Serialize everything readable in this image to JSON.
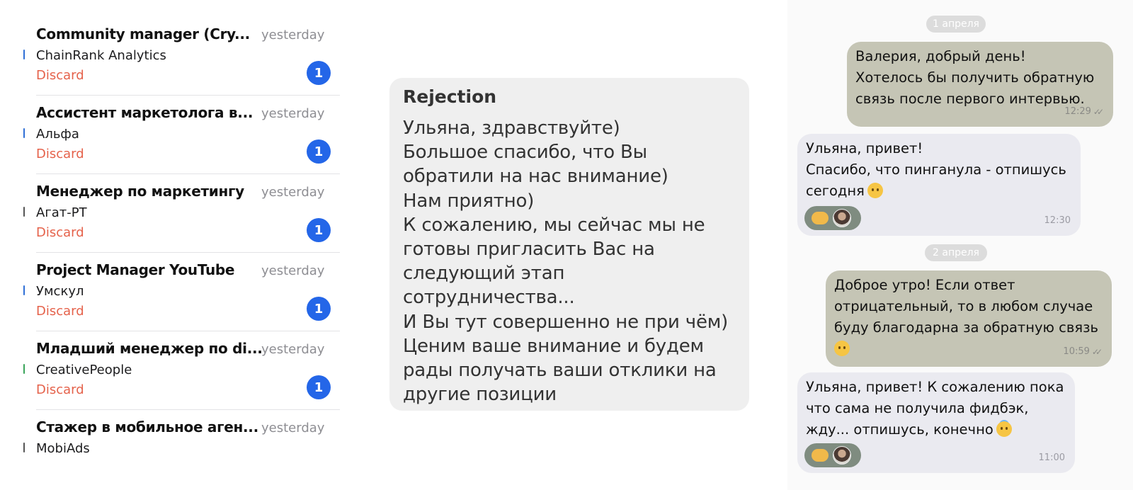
{
  "jobs": [
    {
      "title": "Community manager (Cry...",
      "time": "yesterday",
      "company": "ChainRank Analytics",
      "action": "Discard",
      "badge": "1",
      "edge_color": "#2f6fd6"
    },
    {
      "title": "Ассистент маркетолога в...",
      "time": "yesterday",
      "company": "Альфа",
      "action": "Discard",
      "badge": "1",
      "edge_color": "#2f6fd6"
    },
    {
      "title": "Менеджер по маркетингу",
      "time": "yesterday",
      "company": "Агат-РТ",
      "action": "Discard",
      "badge": "1",
      "edge_color": "#555555"
    },
    {
      "title": "Project Manager YouTube",
      "time": "yesterday",
      "company": "Умскул",
      "action": "Discard",
      "badge": "1",
      "edge_color": "#2f6fd6"
    },
    {
      "title": "Младший менеджер по di...",
      "time": "yesterday",
      "company": "CreativePeople",
      "action": "Discard",
      "badge": "1",
      "edge_color": "#3aa45a"
    },
    {
      "title": "Стажер в мобильное аген...",
      "time": "yesterday",
      "company": "MobiAds",
      "action": "",
      "badge": "",
      "edge_color": "#555555"
    }
  ],
  "rejection": {
    "title": "Rejection",
    "lines": [
      "Ульяна, здравствуйте)",
      "Большое спасибо, что Вы",
      "обратили на нас внимание)",
      "Нам приятно)",
      "К сожалению, мы сейчас мы не",
      "готовы пригласить Вас на",
      "следующий этап",
      "сотрудничества...",
      "И Вы тут совершенно не при чём)",
      "Ценим ваше внимание и будем",
      "рады получать ваши отклики на",
      "другие позиции"
    ]
  },
  "chat": {
    "date1": "1 апреля",
    "date2": "2 апреля",
    "msg1": {
      "lines": [
        "Валерия, добрый день!",
        "Хотелось бы получить обратную",
        "связь после первого интервью."
      ],
      "time": "12:29"
    },
    "msg2": {
      "lines": [
        "Ульяна, привет!",
        "Спасибо, что пинганула - отпишусь",
        "сегодня"
      ],
      "time": "12:30"
    },
    "msg3": {
      "lines": [
        "Доброе утро! Если ответ",
        "отрицательный, то в любом случае",
        "буду благодарна за обратную связь"
      ],
      "time": "10:59"
    },
    "msg4": {
      "lines": [
        "Ульяна, привет! К сожалению пока",
        "что сама не получила фидбэк,",
        "жду... отпишусь, конечно"
      ],
      "time": "11:00"
    }
  },
  "colors": {
    "discard": "#e5624b",
    "badge": "#2466e8",
    "outgoing_bubble": "#c5c5b5",
    "incoming_bubble": "#eaeaf0"
  }
}
